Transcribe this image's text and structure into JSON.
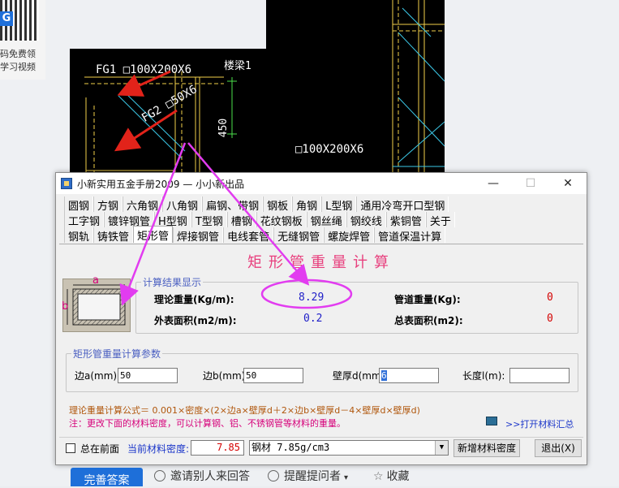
{
  "sidebar": {
    "qr_line1": "码免费领",
    "qr_line2": "学习视频",
    "qr_logo": "G"
  },
  "cad": {
    "label_fg1": "FG1 □100X200X6",
    "label_beam": "楼梁1",
    "label_fg2": "FG2 □50X6",
    "label_dim": "450",
    "label_box": "□100X200X6"
  },
  "window": {
    "title": "小新实用五金手册2009 — 小小新出品",
    "minimize": "—",
    "maximize": "☐",
    "close": "✕"
  },
  "tabs": {
    "row1": [
      "圆钢",
      "方钢",
      "六角钢",
      "八角钢",
      "扁钢、带钢",
      "钢板",
      "角钢",
      "L型钢",
      "通用冷弯开口型钢"
    ],
    "row2": [
      "工字钢",
      "镀锌钢管",
      "H型钢",
      "T型钢",
      "槽钢",
      "花纹钢板",
      "钢丝绳",
      "钢绞线",
      "紫铜管",
      "关于"
    ],
    "row3": [
      "钢轨",
      "铸铁管",
      "矩形管",
      "焊接钢管",
      "电线套管",
      "无缝钢管",
      "螺旋焊管",
      "管道保温计算"
    ]
  },
  "main": {
    "heading": "矩形管重量计算",
    "diagram": {
      "label_a": "a",
      "label_b": "b"
    },
    "results": {
      "title": "计算结果显示",
      "theory_weight_label": "理论重量(Kg/m):",
      "theory_weight_value": "8.29",
      "pipe_weight_label": "管道重量(Kg):",
      "pipe_weight_value": "0",
      "outer_area_label": "外表面积(m2/m):",
      "outer_area_value": "0.2",
      "total_area_label": "总表面积(m2):",
      "total_area_value": "0"
    },
    "params": {
      "title": "矩形管重量计算参数",
      "side_a_label": "边a(mm):",
      "side_a_value": "50",
      "side_b_label": "边b(mm):",
      "side_b_value": "50",
      "thickness_label": "壁厚d(mm)",
      "thickness_value": "6",
      "length_label": "长度l(m):",
      "length_value": ""
    },
    "formula": "理论重量计算公式＝ 0.001×密度×(2×边a×壁厚d＋2×边b×壁厚d－4×壁厚d×壁厚d)",
    "note": "注：更改下面的材料密度，可以计算钢、铝、不锈钢管等材料的重量。",
    "open_summary": ">>打开材料汇总"
  },
  "bottom": {
    "stay_on_top": "总在前面",
    "density_label": "当前材料密度:",
    "density_value": "7.85",
    "material_select": "钢材 7.85g/cm3",
    "add_material": "新增材料密度",
    "exit": "退出(X)"
  },
  "below": {
    "improve_answer": "完善答案",
    "invite": "邀请别人来回答",
    "remind": "提醒提问者",
    "favorite": "收藏"
  },
  "colors": {
    "accent_pink": "#e8407e",
    "value_blue": "#1f1fc8",
    "value_red": "#d40000",
    "group_blue": "#4a5fc1",
    "annotation_magenta": "#e23cf0",
    "arrow_red": "#e2231a"
  }
}
